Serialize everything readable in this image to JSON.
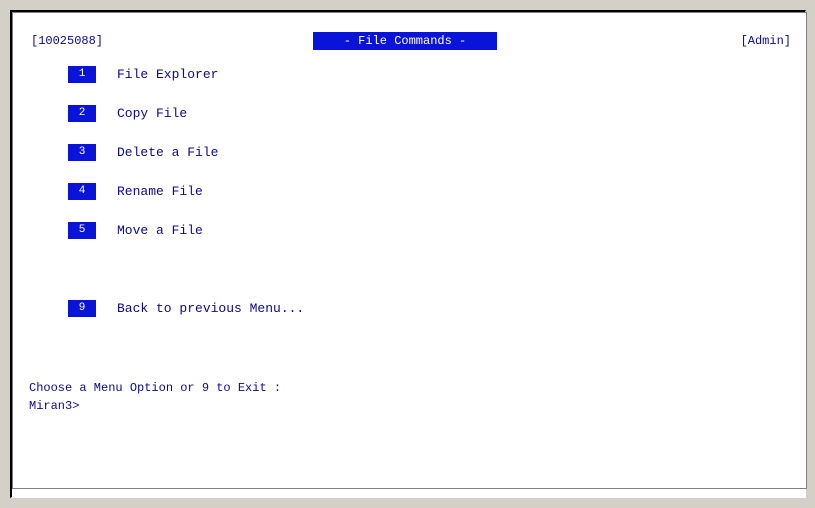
{
  "header": {
    "session_id": "[10025088]",
    "title": "- File Commands -",
    "user_role": "[Admin]"
  },
  "menu": {
    "items": [
      {
        "number": "1",
        "label": "File Explorer"
      },
      {
        "number": "2",
        "label": "Copy File"
      },
      {
        "number": "3",
        "label": "Delete a File"
      },
      {
        "number": "4",
        "label": "Rename File"
      },
      {
        "number": "5",
        "label": "Move a File"
      },
      {
        "number": "9",
        "label": "Back to previous Menu..."
      }
    ]
  },
  "prompt": {
    "instruction": "Choose a Menu Option or 9 to Exit :",
    "cursor_prompt": "Miran3>"
  },
  "colors": {
    "accent": "#0a14d8",
    "text": "#0a0a8c",
    "background": "#ffffff"
  }
}
